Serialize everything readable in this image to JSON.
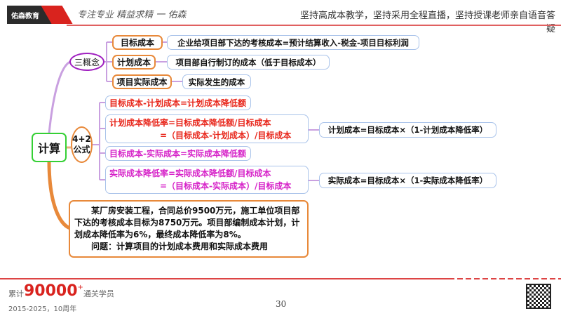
{
  "header": {
    "logo": "佑森教育",
    "signature": "专注专业 精益求精 一 佑森",
    "slogan": "坚持高成本教学，坚持采用全程直播，坚持授课老师亲自语音答疑"
  },
  "mindmap": {
    "root": "计算",
    "concepts": {
      "label": "三概念",
      "items": [
        {
          "term": "目标成本",
          "def": "企业给项目部下达的考核成本=预计结算收入-税金-项目目标利润"
        },
        {
          "term": "计划成本",
          "def": "项目部自行制订的成本（低于目标成本）"
        },
        {
          "term": "项目实际成本",
          "def": "实际发生的成本"
        }
      ]
    },
    "formulas": {
      "label_1": "4+2",
      "label_2": "公式",
      "items": [
        {
          "line1": "目标成本-计划成本=计划成本降低额"
        },
        {
          "line1": "计划成本降低率=目标成本降低额/目标成本",
          "line2": "=（目标成本-计划成本）/目标成本",
          "result": "计划成本=目标成本×（1-计划成本降低率）"
        },
        {
          "line1": "目标成本-实际成本=实际成本降低额"
        },
        {
          "line1": "实际成本降低率=实际成本降低额/目标成本",
          "line2": "=（目标成本-实际成本）/目标成本",
          "result": "实际成本=目标成本×（1-实际成本降低率）"
        }
      ]
    },
    "problem": {
      "text": "某厂房安装工程，合同总价9500万元，施工单位项目部下达的考核成本目标为8750万元。项目部编制成本计划，计划成本降低率为6%，最终成本降低率为8%。",
      "question": "问题：计算项目的计划成本费用和实际成本费用"
    }
  },
  "footer": {
    "prefix": "累计",
    "count": "90000",
    "plus": "+",
    "suffix": "通关学员",
    "years": "2015-2025，10周年",
    "page": "30"
  },
  "colors": {
    "accent": "#d9231e",
    "red_text": "#e8261b",
    "magenta_text": "#d622c8",
    "green": "#35d035",
    "purple": "#a020c0",
    "orange": "#e8893a"
  }
}
